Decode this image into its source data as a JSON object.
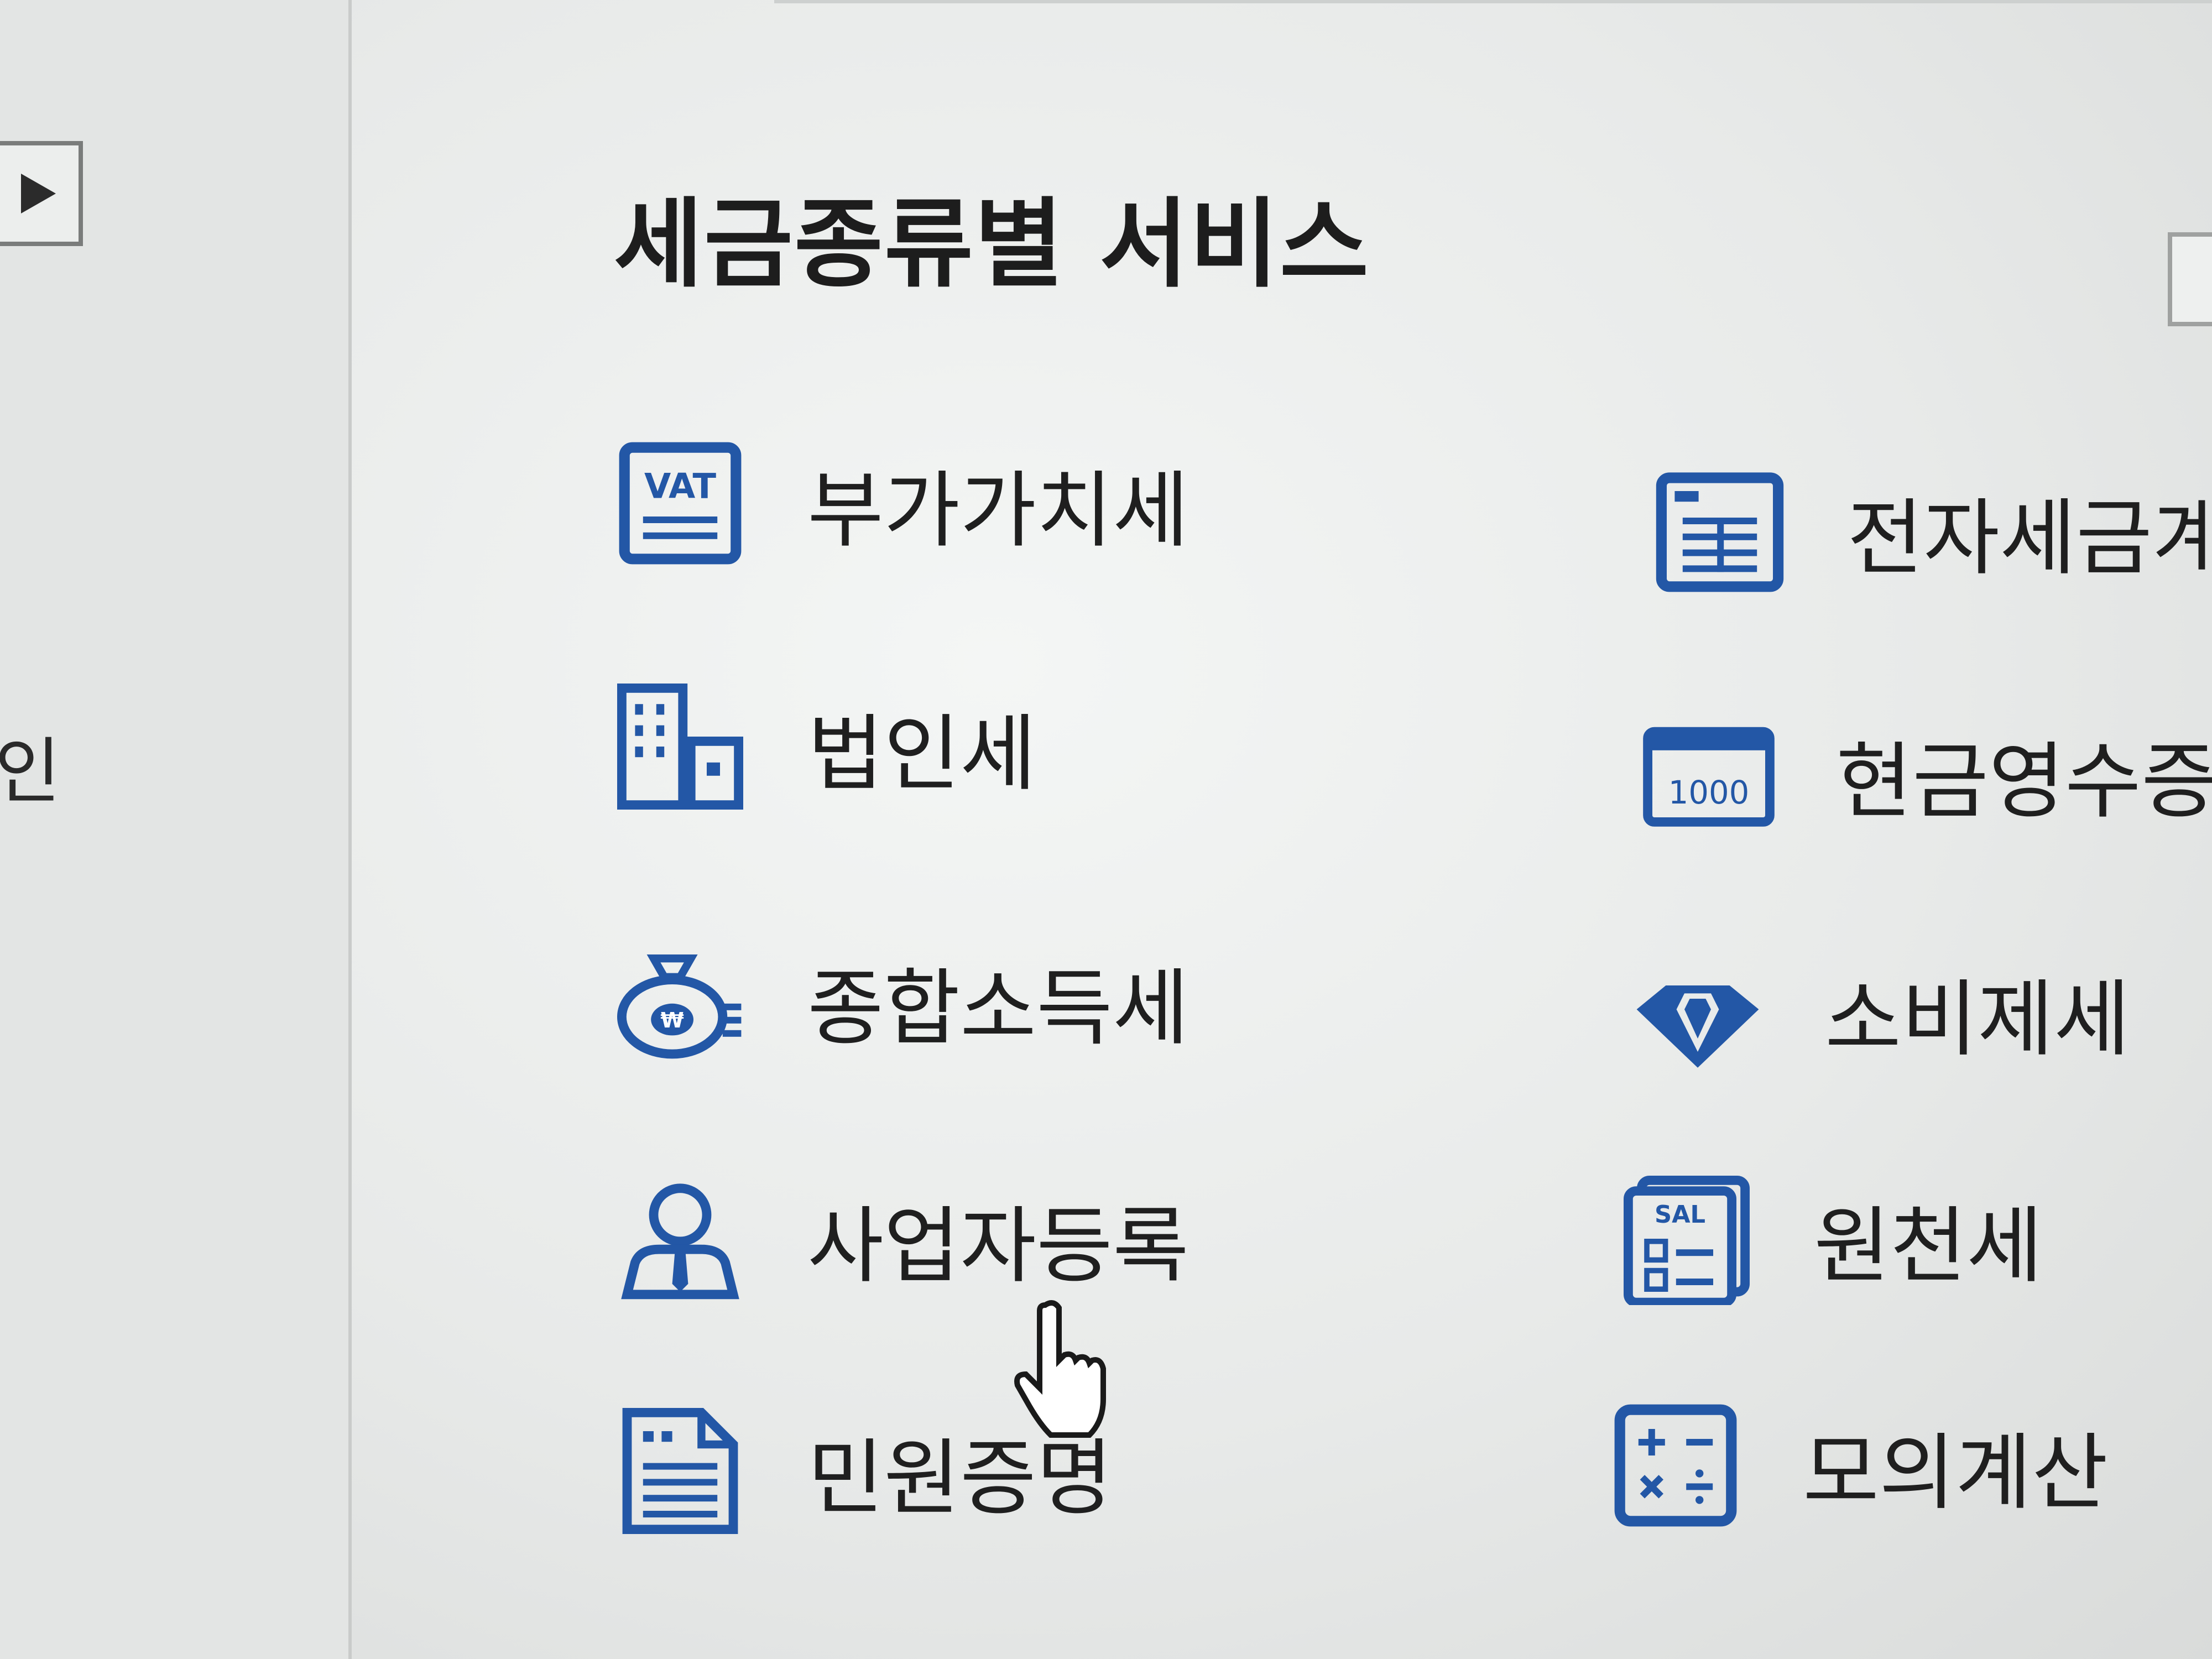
{
  "sidebar": {
    "fragment_text": "인"
  },
  "section": {
    "title": "세금종류별 서비스"
  },
  "services": {
    "left": [
      {
        "label": "부가가치세",
        "icon": "vat-document-icon"
      },
      {
        "label": "법인세",
        "icon": "corporate-building-icon"
      },
      {
        "label": "종합소득세",
        "icon": "money-bag-won-icon"
      },
      {
        "label": "사업자등록",
        "icon": "person-registration-icon"
      },
      {
        "label": "민원증명",
        "icon": "certificate-document-icon"
      }
    ],
    "right": [
      {
        "label": "전자세금계산",
        "icon": "electronic-invoice-icon"
      },
      {
        "label": "현금영수증",
        "icon": "cash-receipt-1000-icon",
        "icon_text": "1000"
      },
      {
        "label": "소비제세",
        "icon": "diamond-icon"
      },
      {
        "label": "원천세",
        "icon": "salary-statement-icon",
        "icon_text": "SAL"
      },
      {
        "label": "모의계산",
        "icon": "calculator-icon"
      }
    ]
  },
  "colors": {
    "icon_blue": "#2357a6",
    "text": "#1f1f1f",
    "background": "#e9ebea"
  }
}
